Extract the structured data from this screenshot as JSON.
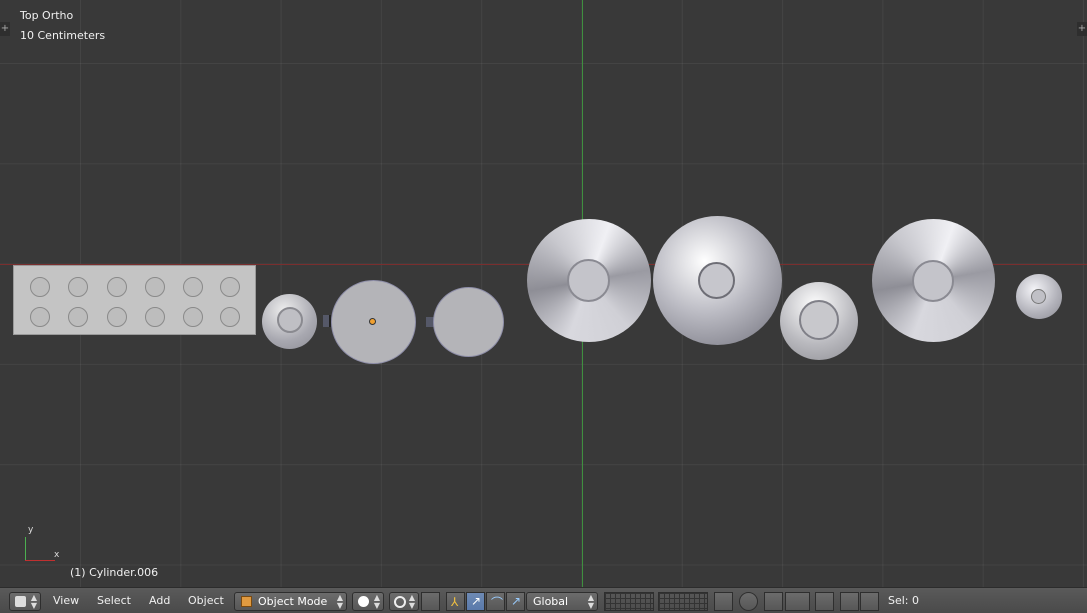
{
  "viewport": {
    "view_name": "Top Ortho",
    "grid_scale": "10 Centimeters",
    "active_object": "(1) Cylinder.006",
    "axis_labels": {
      "x": "x",
      "y": "y"
    }
  },
  "header": {
    "menus": {
      "view": "View",
      "select": "Select",
      "add": "Add",
      "object": "Object"
    },
    "mode": "Object Mode",
    "orientation": "Global",
    "selection_count": "Sel: 0"
  },
  "colors": {
    "background": "#393939",
    "x_axis": "#7a2e2e",
    "y_axis": "#3f8f3f",
    "active_manipulator": "#5a7aab"
  },
  "icons": [
    "3d-view-editor-icon",
    "shading-solid-icon",
    "pivot-icon",
    "translate-icon",
    "rotate-icon",
    "scale-icon",
    "layers-icon",
    "lock-icon",
    "proportional-icon",
    "snap-icon",
    "render-icon",
    "clapper-icon"
  ]
}
